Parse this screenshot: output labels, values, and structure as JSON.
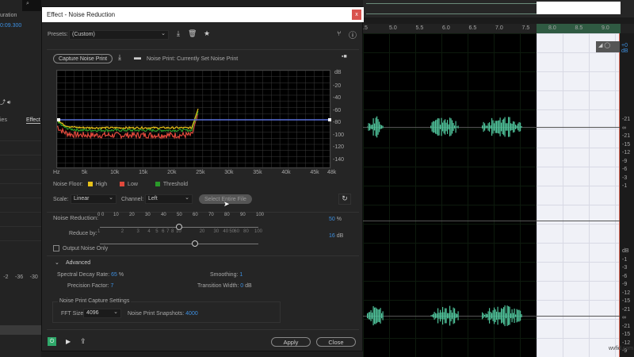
{
  "left_panel": {
    "duration_label": "uration",
    "duration_value": "0:09.300",
    "tab_a": "ies",
    "tab_b": "Effect",
    "meter_ticks": [
      "-2",
      "-36",
      "-30"
    ]
  },
  "dialog": {
    "title": "Effect - Noise Reduction",
    "close": "x",
    "presets_label": "Presets:",
    "preset_value": "(Custom)",
    "capture_button": "Capture Noise Print",
    "noise_print_status": "Noise Print: Currently Set Noise Print",
    "graph": {
      "y_unit": "dB",
      "y_ticks": [
        "-20",
        "-40",
        "-60",
        "-80",
        "-100",
        "-120",
        "-140"
      ],
      "x_ticks": [
        "Hz",
        "5k",
        "10k",
        "15k",
        "20k",
        "25k",
        "30k",
        "35k",
        "40k",
        "45k",
        "48k"
      ],
      "threshold_db": -80
    },
    "legend": {
      "label": "Noise Floor:",
      "high": "High",
      "low": "Low",
      "threshold": "Threshold",
      "colors": {
        "high": "#e8c21a",
        "low": "#e0493c",
        "threshold": "#2a9a2a"
      }
    },
    "scale_label": "Scale:",
    "scale_value": "Linear",
    "channel_label": "Channel:",
    "channel_value": "Left",
    "select_entire_file": "Select Entire File",
    "noise_reduction": {
      "label": "Noise Reduction:",
      "ticks": [
        "0 0",
        "10",
        "20",
        "30",
        "40",
        "50",
        "60",
        "70",
        "80",
        "90",
        "100"
      ],
      "value": "50",
      "unit": "%",
      "fraction": 0.5
    },
    "reduce_by": {
      "label": "Reduce by:",
      "ticks": [
        "1",
        "2",
        "3",
        "4",
        "5",
        "6",
        "7",
        "8",
        "10",
        "20",
        "30",
        "40",
        "50",
        "60",
        "80",
        "100"
      ],
      "value": "16",
      "unit": "dB",
      "fraction": 0.6
    },
    "output_noise_only": "Output Noise Only",
    "advanced": {
      "title": "Advanced",
      "spectral_decay_label": "Spectral Decay Rate:",
      "spectral_decay_value": "65",
      "spectral_decay_unit": "%",
      "smoothing_label": "Smoothing:",
      "smoothing_value": "1",
      "precision_label": "Precision Factor:",
      "precision_value": "7",
      "transition_label": "Transition Width:",
      "transition_value": "0",
      "transition_unit": "dB"
    },
    "capture_settings": {
      "title": "Noise Print Capture Settings",
      "fft_label": "FFT Size:",
      "fft_value": "4096",
      "snapshots_label": "Noise Print Snapshots:",
      "snapshots_value": "4000"
    },
    "apply": "Apply",
    "close_button": "Close"
  },
  "editor": {
    "ruler": [
      "5.0",
      "5.5",
      "6.0",
      "6.5",
      "7.0",
      "7.5",
      "8.0",
      "8.5",
      "9.0"
    ],
    "ruler_first": ".5",
    "gain": "+0 dB",
    "db_scale_top": [
      "-21",
      "∞",
      "-21",
      "-15",
      "-12",
      "-9",
      "-6",
      "-3",
      "-1"
    ],
    "db_scale_mid": [
      "dB",
      "-1",
      "-3",
      "-6",
      "-9",
      "-12",
      "-15",
      "-21",
      "∞",
      "-21",
      "-15",
      "-12",
      "-9"
    ],
    "watermark": "wvfid.com"
  }
}
